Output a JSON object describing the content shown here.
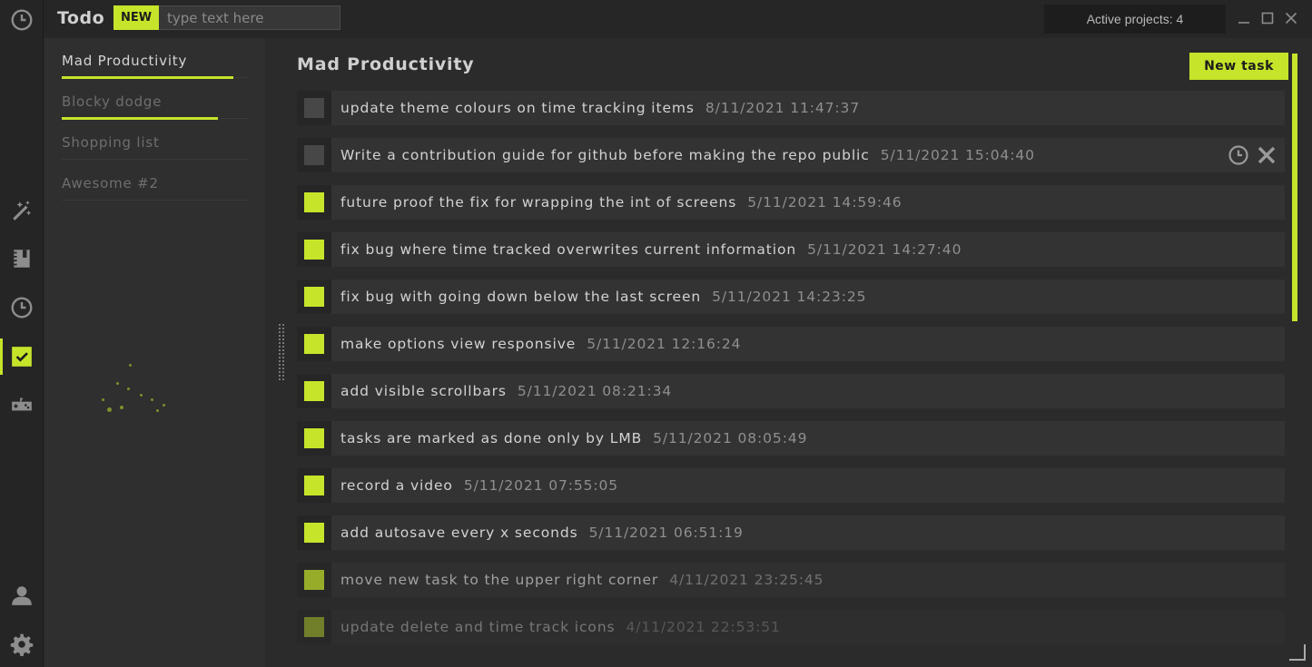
{
  "app": {
    "title": "Todo",
    "new_badge": "NEW",
    "quick_placeholder": "type text here",
    "active_projects": "Active projects: 4"
  },
  "rail": {
    "top_icon": "clock-icon",
    "items": [
      {
        "icon": "magic-wand-icon",
        "active": false
      },
      {
        "icon": "notebook-icon",
        "active": false
      },
      {
        "icon": "clock-icon",
        "active": false
      },
      {
        "icon": "checkbox-icon",
        "active": true
      },
      {
        "icon": "gamepad-icon",
        "active": false
      }
    ],
    "bottom": [
      {
        "icon": "user-icon"
      },
      {
        "icon": "gear-icon"
      }
    ]
  },
  "projects": [
    {
      "name": "Mad Productivity",
      "progress": 0.92,
      "selected": true
    },
    {
      "name": "Blocky dodge",
      "progress": 0.84,
      "selected": false
    },
    {
      "name": "Shopping list",
      "progress": 0,
      "selected": false
    },
    {
      "name": "Awesome #2",
      "progress": 0,
      "selected": false
    }
  ],
  "main": {
    "title": "Mad Productivity",
    "new_task_label": "New task",
    "tasks": [
      {
        "text": "update theme colours on time tracking items",
        "time": "8/11/2021 11:47:37",
        "done": false,
        "hover": false
      },
      {
        "text": "Write a contribution guide for github before making the repo public",
        "time": "5/11/2021 15:04:40",
        "done": false,
        "hover": true
      },
      {
        "text": "future proof the fix for wrapping the int of screens",
        "time": "5/11/2021 14:59:46",
        "done": true,
        "hover": false
      },
      {
        "text": "fix bug where time tracked overwrites current information",
        "time": "5/11/2021 14:27:40",
        "done": true,
        "hover": false
      },
      {
        "text": "fix bug with going down below the last screen",
        "time": "5/11/2021 14:23:25",
        "done": true,
        "hover": false
      },
      {
        "text": "make options view responsive",
        "time": "5/11/2021 12:16:24",
        "done": true,
        "hover": false
      },
      {
        "text": "add visible scrollbars",
        "time": "5/11/2021 08:21:34",
        "done": true,
        "hover": false
      },
      {
        "text": "tasks are marked as done only by LMB",
        "time": "5/11/2021 08:05:49",
        "done": true,
        "hover": false
      },
      {
        "text": "record a video",
        "time": "5/11/2021 07:55:05",
        "done": true,
        "hover": false
      },
      {
        "text": "add autosave every x seconds",
        "time": "5/11/2021 06:51:19",
        "done": true,
        "hover": false
      },
      {
        "text": "move new task to the upper right corner",
        "time": "4/11/2021 23:25:45",
        "done": true,
        "hover": false
      },
      {
        "text": "update delete and time track icons",
        "time": "4/11/2021 22:53:51",
        "done": true,
        "hover": false
      }
    ]
  },
  "colors": {
    "accent": "#c6e42a",
    "bg": "#2b2b2b",
    "panel": "#2f2f2f",
    "row": "#333333"
  }
}
